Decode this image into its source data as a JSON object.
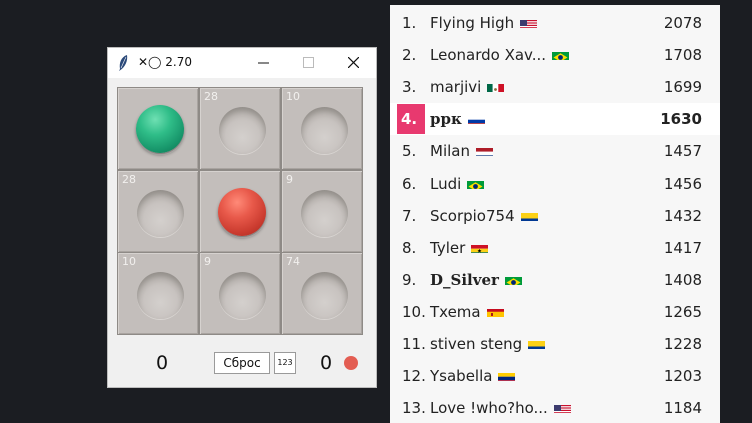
{
  "window": {
    "title": "✕◯ 2.70",
    "controls": [
      "minimize",
      "maximize",
      "close"
    ]
  },
  "board": {
    "cells": [
      {
        "number": "",
        "piece": "green"
      },
      {
        "number": "28",
        "piece": ""
      },
      {
        "number": "10",
        "piece": ""
      },
      {
        "number": "28",
        "piece": ""
      },
      {
        "number": "",
        "piece": "red"
      },
      {
        "number": "9",
        "piece": ""
      },
      {
        "number": "10",
        "piece": ""
      },
      {
        "number": "9",
        "piece": ""
      },
      {
        "number": "74",
        "piece": ""
      }
    ]
  },
  "footer": {
    "score_left": "0",
    "reset_label": "Сброс",
    "numbers_label": "123",
    "score_right": "0",
    "turn_color": "#e35d52"
  },
  "leaderboard": {
    "highlight_color": "#e8396f",
    "rows": [
      {
        "rank": "1.",
        "name": "Flying High",
        "flag": "us",
        "score": "2078",
        "highlight": false,
        "bold": false
      },
      {
        "rank": "2.",
        "name": "Leonardo Xav...",
        "flag": "br",
        "score": "1708",
        "highlight": false,
        "bold": false
      },
      {
        "rank": "3.",
        "name": "marjivi",
        "flag": "mx",
        "score": "1699",
        "highlight": false,
        "bold": false
      },
      {
        "rank": "4.",
        "name": "ррк",
        "flag": "ru",
        "score": "1630",
        "highlight": true,
        "bold": true
      },
      {
        "rank": "5.",
        "name": "Milan",
        "flag": "nl",
        "score": "1457",
        "highlight": false,
        "bold": false
      },
      {
        "rank": "6.",
        "name": "Ludi",
        "flag": "br",
        "score": "1456",
        "highlight": false,
        "bold": false
      },
      {
        "rank": "7.",
        "name": "Scorpio754",
        "flag": "co",
        "score": "1432",
        "highlight": false,
        "bold": false
      },
      {
        "rank": "8.",
        "name": "Tyler",
        "flag": "gh",
        "score": "1417",
        "highlight": false,
        "bold": false
      },
      {
        "rank": "9.",
        "name": "D_Silver",
        "flag": "br",
        "score": "1408",
        "highlight": false,
        "bold": "name"
      },
      {
        "rank": "10.",
        "name": "Txema",
        "flag": "es",
        "score": "1265",
        "highlight": false,
        "bold": false
      },
      {
        "rank": "11.",
        "name": "stiven steng",
        "flag": "co",
        "score": "1228",
        "highlight": false,
        "bold": false
      },
      {
        "rank": "12.",
        "name": "Ysabella",
        "flag": "ve",
        "score": "1203",
        "highlight": false,
        "bold": false
      },
      {
        "rank": "13.",
        "name": "Love !who?ho...",
        "flag": "us",
        "score": "1184",
        "highlight": false,
        "bold": false
      }
    ]
  }
}
